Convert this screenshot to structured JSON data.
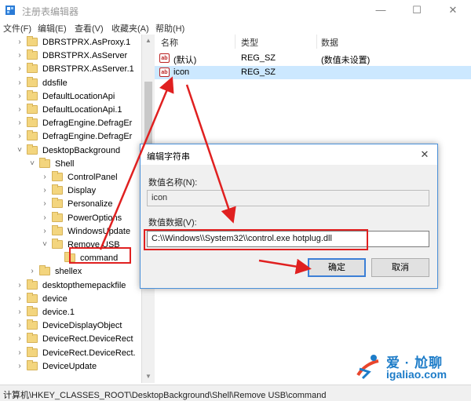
{
  "window": {
    "title": "注册表编辑器"
  },
  "menu": [
    "文件(F)",
    "编辑(E)",
    "查看(V)",
    "收藏夹(A)",
    "帮助(H)"
  ],
  "tree": {
    "items": [
      {
        "label": "DBRSTPRX.AsProxy.1",
        "level": 0,
        "expand": "›"
      },
      {
        "label": "DBRSTPRX.AsServer",
        "level": 0,
        "expand": "›"
      },
      {
        "label": "DBRSTPRX.AsServer.1",
        "level": 0,
        "expand": "›"
      },
      {
        "label": "ddsfile",
        "level": 0,
        "expand": "›"
      },
      {
        "label": "DefaultLocationApi",
        "level": 0,
        "expand": "›"
      },
      {
        "label": "DefaultLocationApi.1",
        "level": 0,
        "expand": "›"
      },
      {
        "label": "DefragEngine.DefragEr",
        "level": 0,
        "expand": "›"
      },
      {
        "label": "DefragEngine.DefragEr",
        "level": 0,
        "expand": "›"
      },
      {
        "label": "DesktopBackground",
        "level": 0,
        "expand": "˅"
      },
      {
        "label": "Shell",
        "level": 1,
        "expand": "˅"
      },
      {
        "label": "ControlPanel",
        "level": 2,
        "expand": "›"
      },
      {
        "label": "Display",
        "level": 2,
        "expand": "›"
      },
      {
        "label": "Personalize",
        "level": 2,
        "expand": "›"
      },
      {
        "label": "PowerOptions",
        "level": 2,
        "expand": "›"
      },
      {
        "label": "WindowsUpdate",
        "level": 2,
        "expand": "›"
      },
      {
        "label": "Remove USB",
        "level": 2,
        "expand": "˅"
      },
      {
        "label": "command",
        "level": 3,
        "expand": ""
      },
      {
        "label": "shellex",
        "level": 1,
        "expand": "›"
      },
      {
        "label": "desktopthemepackfile",
        "level": 0,
        "expand": "›"
      },
      {
        "label": "device",
        "level": 0,
        "expand": "›"
      },
      {
        "label": "device.1",
        "level": 0,
        "expand": "›"
      },
      {
        "label": "DeviceDisplayObject",
        "level": 0,
        "expand": "›"
      },
      {
        "label": "DeviceRect.DeviceRect",
        "level": 0,
        "expand": "›"
      },
      {
        "label": "DeviceRect.DeviceRect.",
        "level": 0,
        "expand": "›"
      },
      {
        "label": "DeviceUpdate",
        "level": 0,
        "expand": "›"
      }
    ]
  },
  "values": {
    "headers": [
      "名称",
      "类型",
      "数据"
    ],
    "rows": [
      {
        "name": "(默认)",
        "type": "REG_SZ",
        "data": "(数值未设置)",
        "icon": "ab"
      },
      {
        "name": "icon",
        "type": "REG_SZ",
        "data": "",
        "icon": "ab"
      }
    ]
  },
  "status": "计算机\\HKEY_CLASSES_ROOT\\DesktopBackground\\Shell\\Remove USB\\command",
  "dialog": {
    "title": "编辑字符串",
    "close": "✕",
    "name_label": "数值名称(N):",
    "name_value": "icon",
    "data_label": "数值数据(V):",
    "data_value": "C:\\\\Windows\\\\System32\\\\control.exe hotplug.dll",
    "ok": "确定",
    "cancel": "取消"
  },
  "watermark": {
    "cn": "爱 · 尬聊",
    "en": "igaliao.com"
  },
  "colors": {
    "highlight": "#e02020",
    "selection": "#cce8ff",
    "folder": "#f3d57e",
    "accent": "#3c7fd6"
  }
}
